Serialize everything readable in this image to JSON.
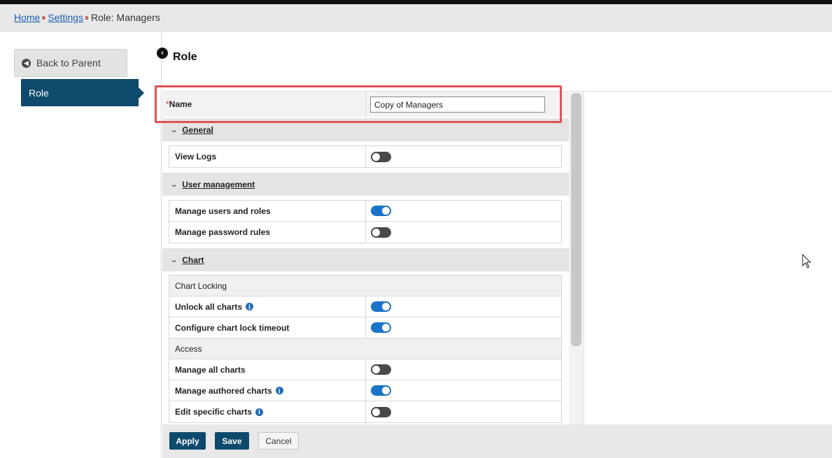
{
  "breadcrumb": {
    "home": "Home",
    "settings": "Settings",
    "current": "Role: Managers",
    "separator": "››"
  },
  "sidebar": {
    "back_label": "Back to Parent",
    "active_item": "Role"
  },
  "page": {
    "title": "Role"
  },
  "form": {
    "name_label": "Name",
    "required_mark": "*",
    "name_value": "Copy of Managers"
  },
  "sections": {
    "general": {
      "title": "General",
      "rows": [
        {
          "label": "View Logs",
          "enabled": false
        }
      ]
    },
    "user_management": {
      "title": "User management",
      "rows": [
        {
          "label": "Manage users and roles",
          "enabled": true
        },
        {
          "label": "Manage password rules",
          "enabled": false
        }
      ]
    },
    "chart": {
      "title": "Chart",
      "subgroups": [
        {
          "title": "Chart Locking",
          "rows": [
            {
              "label": "Unlock all charts",
              "info": true,
              "enabled": true
            },
            {
              "label": "Configure chart lock timeout",
              "info": false,
              "enabled": true
            }
          ]
        },
        {
          "title": "Access",
          "rows": [
            {
              "label": "Manage all charts",
              "info": false,
              "enabled": false
            },
            {
              "label": "Manage authored charts",
              "info": true,
              "enabled": true
            },
            {
              "label": "Edit specific charts",
              "info": true,
              "enabled": false
            }
          ]
        }
      ]
    }
  },
  "footer": {
    "apply": "Apply",
    "save": "Save",
    "cancel": "Cancel"
  },
  "colors": {
    "primary": "#0e4a6b",
    "toggle_on": "#1a74c9",
    "toggle_off": "#4a4a4a",
    "highlight": "#e05255",
    "link": "#1a5fb4"
  },
  "icons": {
    "back": "circle-arrow-left-icon",
    "title": "circle-chevron-left-icon",
    "chevron": "chevron-down-icon",
    "info": "info-icon",
    "cursor": "mouse-pointer-icon"
  }
}
